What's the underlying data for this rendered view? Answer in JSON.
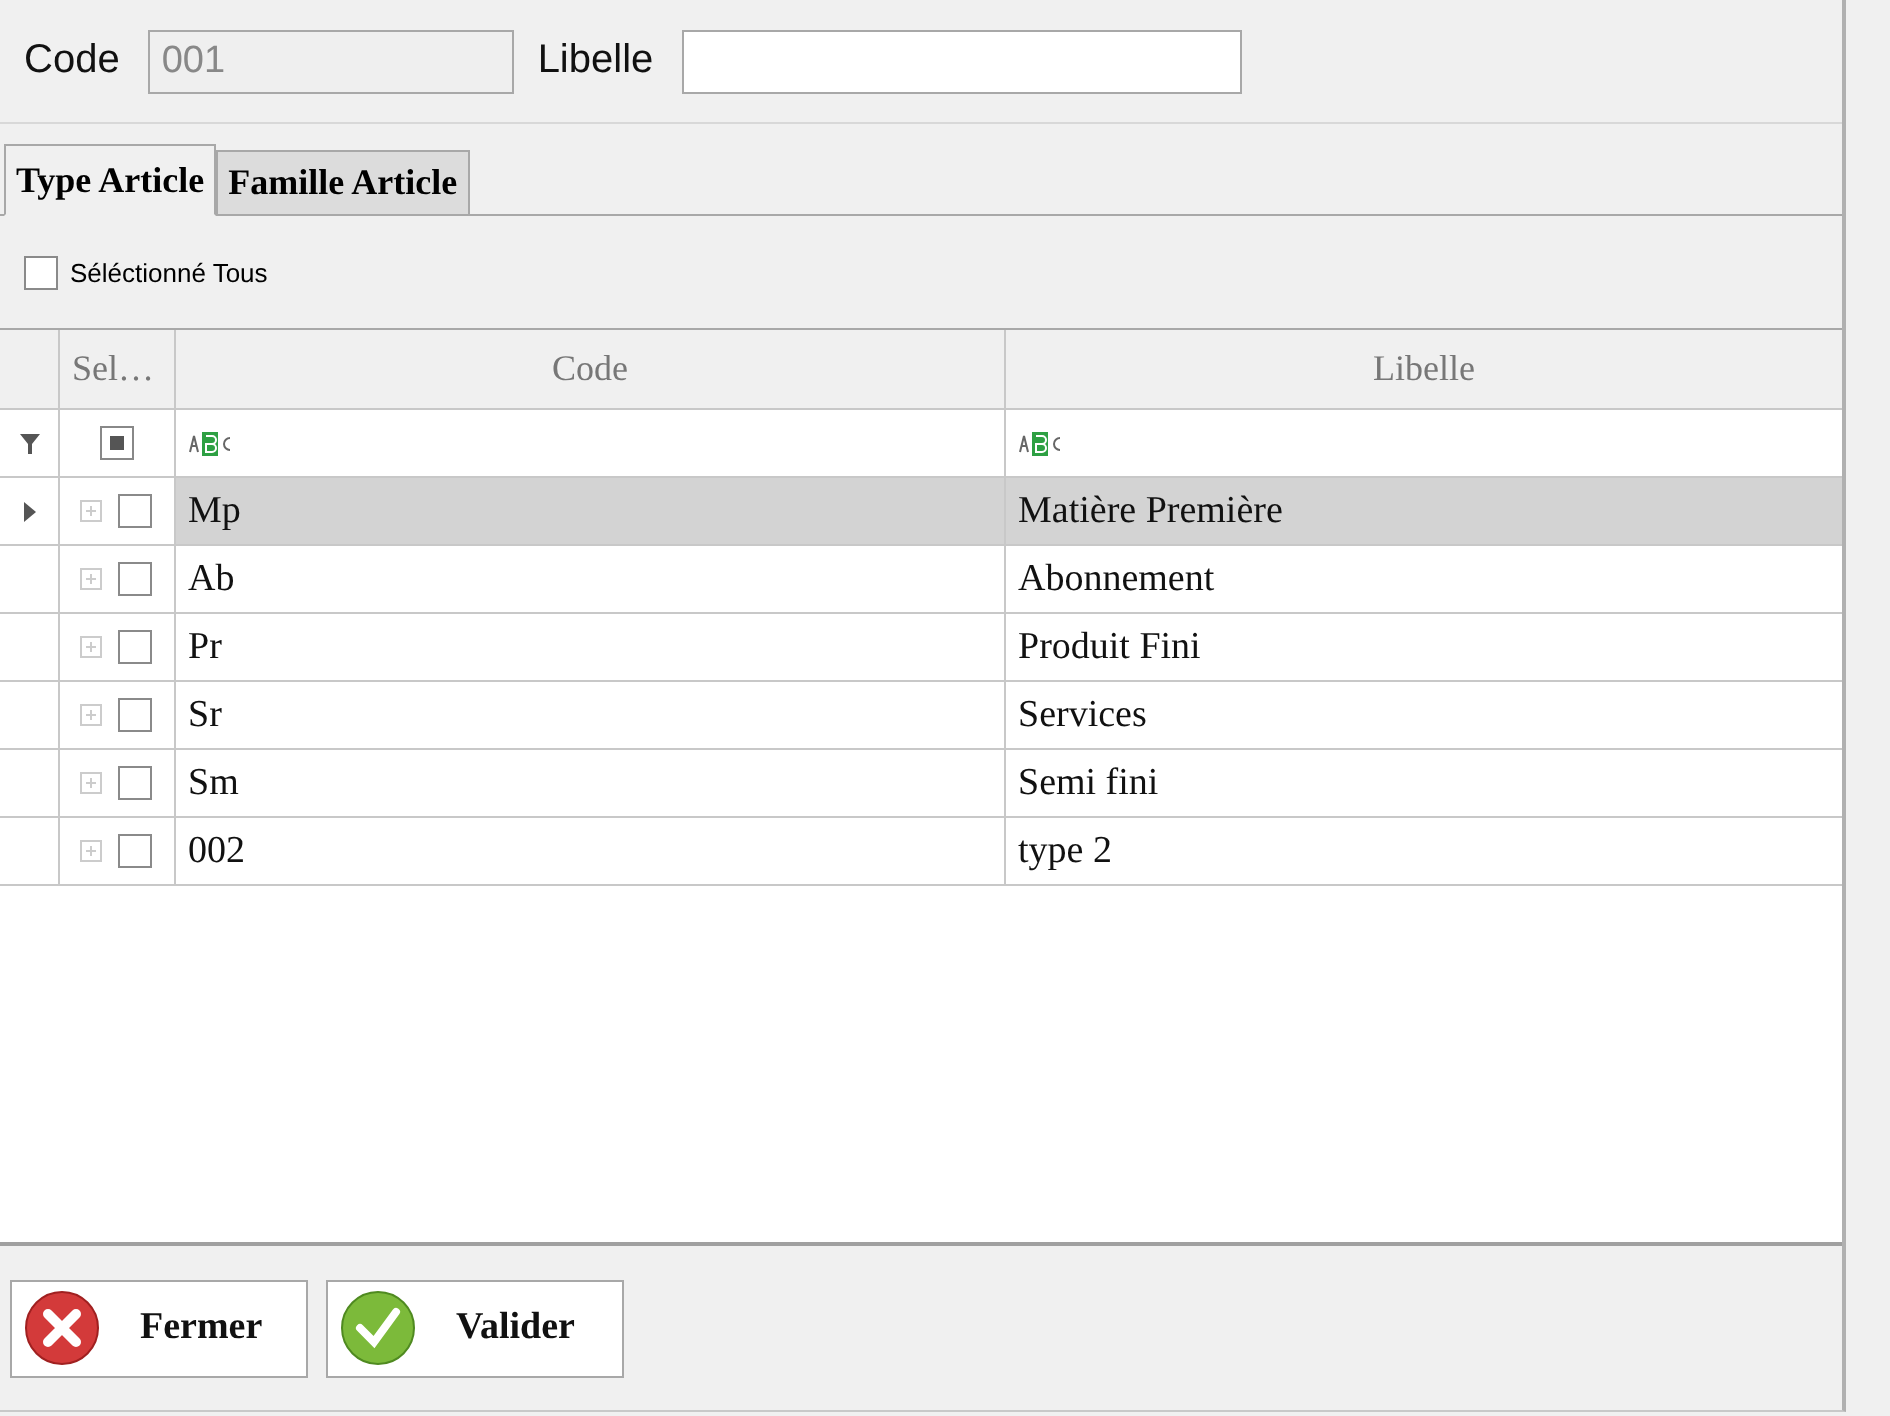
{
  "header": {
    "code_label": "Code",
    "code_value": "001",
    "code_disabled": true,
    "libelle_label": "Libelle"
  },
  "tabs": [
    {
      "label": "Type Article",
      "selected": true
    },
    {
      "label": "Famille Article",
      "selected": false
    }
  ],
  "select_all": {
    "label": "Séléctionné Tous",
    "checked": false
  },
  "table": {
    "columns": [
      "Sel…",
      "Code",
      "Libelle"
    ],
    "filter_checkbox": {
      "indeterminate": true
    },
    "rows": [
      {
        "code": "Mp",
        "libelle": "Matière Première",
        "selected": true,
        "checked": false
      },
      {
        "code": "Ab",
        "libelle": "Abonnement",
        "selected": false,
        "checked": false
      },
      {
        "code": "Pr",
        "libelle": "Produit Fini",
        "selected": false,
        "checked": false
      },
      {
        "code": "Sr",
        "libelle": "Services",
        "selected": false,
        "checked": false
      },
      {
        "code": "Sm",
        "libelle": "Semi fini",
        "selected": false,
        "checked": false
      },
      {
        "code": "002",
        "libelle": "type 2",
        "selected": false,
        "checked": false
      }
    ]
  },
  "buttons": [
    {
      "label": "Fermer",
      "kind": "close"
    },
    {
      "label": "Valider",
      "kind": "ok"
    }
  ]
}
